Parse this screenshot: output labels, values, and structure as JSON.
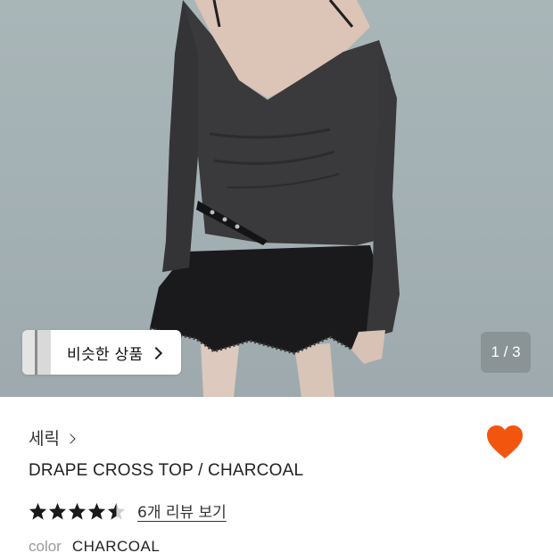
{
  "hero": {
    "image_description_icon": "product-photo",
    "similar_products_label": "비슷한 상품",
    "page_counter": "1 / 3"
  },
  "product": {
    "brand": "세릭",
    "title": "DRAPE CROSS TOP / CHARCOAL",
    "rating": 4.5,
    "review_link": "6개 리뷰 보기",
    "liked": true,
    "color_label": "color",
    "color_value": "CHARCOAL"
  },
  "colors": {
    "heart": "#f2560e",
    "background_wall": "#a6b3b6",
    "garment": "#3a393b"
  }
}
